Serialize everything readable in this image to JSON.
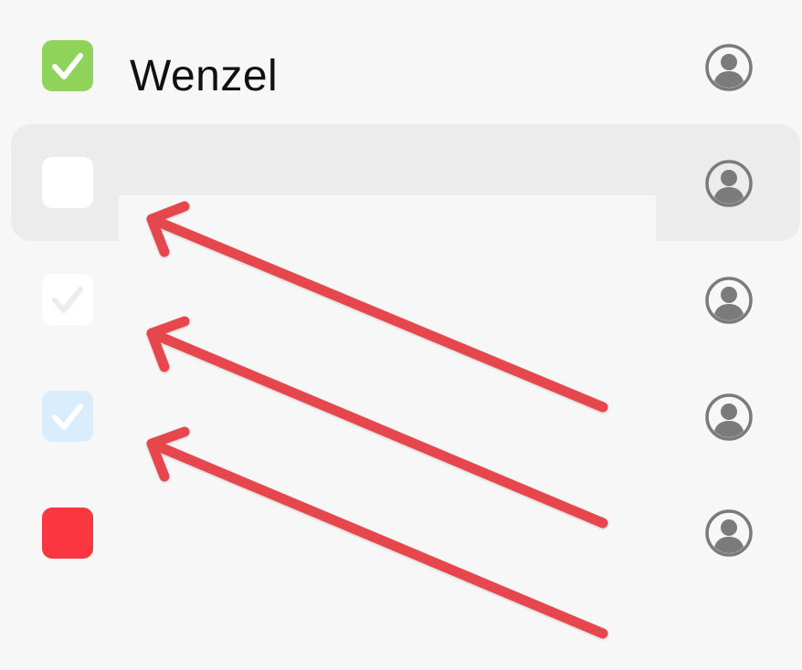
{
  "rows": [
    {
      "label": "Wenzel",
      "checkbox_state": "checked",
      "checkbox_color": "#8fd35a",
      "check_color": "#ffffff",
      "avatar_icon": "person-circle-icon"
    },
    {
      "label": "",
      "checkbox_state": "unchecked",
      "checkbox_color": "#ffffff",
      "selected": true,
      "editing": true,
      "avatar_icon": "person-circle-icon"
    },
    {
      "label": "",
      "checkbox_state": "checked-faded",
      "checkbox_color": "#ffffff",
      "check_color": "#ececec",
      "avatar_icon": "person-circle-icon"
    },
    {
      "label": "",
      "checkbox_state": "checked-faded",
      "checkbox_color": "#d9edfc",
      "check_color": "#ffffff",
      "avatar_icon": "person-circle-icon"
    },
    {
      "label": "",
      "checkbox_state": "unchecked",
      "checkbox_color": "#fa3640",
      "avatar_icon": "person-circle-icon"
    }
  ],
  "annotations": {
    "arrow_color": "#e5464e",
    "arrow_count": 3,
    "arrow_icon": "annotation-arrow"
  },
  "colors": {
    "background": "#f7f7f8",
    "selected_row": "#ececed",
    "avatar": "#7b7b7b"
  }
}
